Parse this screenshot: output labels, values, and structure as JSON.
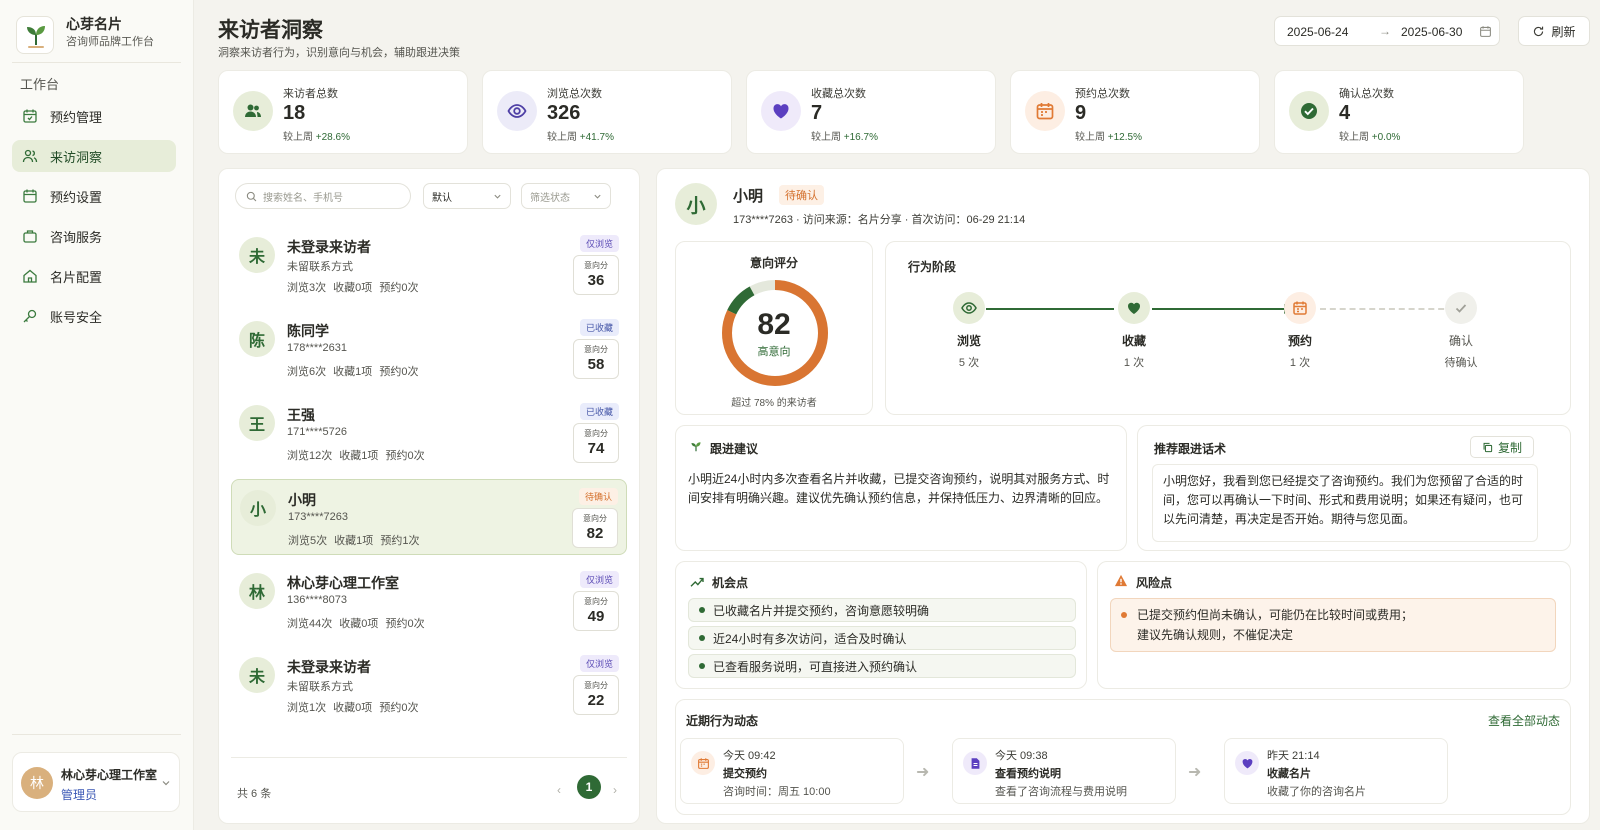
{
  "app": {
    "name": "心芽名片",
    "subtitle": "咨询师品牌工作台"
  },
  "sidebar": {
    "section": "工作台",
    "items": [
      {
        "label": "预约管理",
        "icon": "calendar-icon"
      },
      {
        "label": "来访洞察",
        "icon": "users-icon",
        "active": true
      },
      {
        "label": "预约设置",
        "icon": "calendar-settings-icon"
      },
      {
        "label": "咨询服务",
        "icon": "briefcase-icon"
      },
      {
        "label": "名片配置",
        "icon": "home-icon"
      },
      {
        "label": "账号安全",
        "icon": "key-icon"
      }
    ],
    "user": {
      "avatar": "林",
      "name": "林心芽心理工作室",
      "role": "管理员"
    }
  },
  "header": {
    "title": "来访者洞察",
    "subtitle": "洞察来访者行为，识别意向与机会，辅助跟进决策",
    "date_start": "2025-06-24",
    "date_end": "2025-06-30",
    "refresh_label": "刷新"
  },
  "stats": [
    {
      "label": "来访者总数",
      "value": "18",
      "trend_label": "较上周",
      "trend": "+28.6%",
      "icon": "users-icon",
      "color": "#2f6a35",
      "bg": "#e7edd9"
    },
    {
      "label": "浏览总次数",
      "value": "326",
      "trend_label": "较上周",
      "trend": "+41.7%",
      "icon": "eye-icon",
      "color": "#4e3fa5",
      "bg": "#ecebf8"
    },
    {
      "label": "收藏总次数",
      "value": "7",
      "trend_label": "较上周",
      "trend": "+16.7%",
      "icon": "heart-icon",
      "color": "#5b3fc0",
      "bg": "#efeafa"
    },
    {
      "label": "预约总次数",
      "value": "9",
      "trend_label": "较上周",
      "trend": "+12.5%",
      "icon": "calendar-icon",
      "color": "#e07a35",
      "bg": "#fdeee3"
    },
    {
      "label": "确认总次数",
      "value": "4",
      "trend_label": "较上周",
      "trend": "+0.0%",
      "icon": "check-circle-icon",
      "color": "#2f6a35",
      "bg": "#e7edd9"
    }
  ],
  "list": {
    "search_placeholder": "搜索姓名、手机号",
    "sort_value": "默认",
    "filter_placeholder": "筛选状态",
    "score_label": "意向分",
    "visitors": [
      {
        "avatar": "未",
        "name": "未登录来访者",
        "contact": "未留联系方式",
        "stats": "浏览3次 收藏0项 预约0次",
        "badge": "仅浏览",
        "badge_type": "browse",
        "score": "36"
      },
      {
        "avatar": "陈",
        "name": "陈同学",
        "contact": "178****2631",
        "stats": "浏览6次 收藏1项 预约0次",
        "badge": "已收藏",
        "badge_type": "fav",
        "score": "58"
      },
      {
        "avatar": "王",
        "name": "王强",
        "contact": "171****5726",
        "stats": "浏览12次 收藏1项 预约0次",
        "badge": "已收藏",
        "badge_type": "fav",
        "score": "74"
      },
      {
        "avatar": "小",
        "name": "小明",
        "contact": "173****7263",
        "stats": "浏览5次 收藏1项 预约1次",
        "badge": "待确认",
        "badge_type": "pend",
        "score": "82",
        "active": true
      },
      {
        "avatar": "林",
        "name": "林心芽心理工作室",
        "contact": "136****8073",
        "stats": "浏览44次 收藏0项 预约0次",
        "badge": "仅浏览",
        "badge_type": "browse",
        "score": "49"
      },
      {
        "avatar": "未",
        "name": "未登录来访者",
        "contact": "未留联系方式",
        "stats": "浏览1次 收藏0项 预约0次",
        "badge": "仅浏览",
        "badge_type": "browse",
        "score": "22"
      }
    ],
    "total": "共 6 条",
    "page": "1"
  },
  "detail": {
    "avatar": "小",
    "name": "小明",
    "status": "待确认",
    "meta": "173****7263 · 访问来源：名片分享 · 首次访问：06-29 21:14",
    "score": {
      "title": "意向评分",
      "value": 82,
      "level": "高意向",
      "note": "超过 78% 的来访者",
      "accent": "#d97532",
      "track": "#2f6a35"
    },
    "stages": {
      "title": "行为阶段",
      "items": [
        {
          "name": "浏览",
          "sub": "5 次",
          "icon": "eye-icon",
          "done": true
        },
        {
          "name": "收藏",
          "sub": "1 次",
          "icon": "heart-icon",
          "done": true
        },
        {
          "name": "预约",
          "sub": "1 次",
          "icon": "calendar-icon",
          "done": true
        },
        {
          "name": "确认",
          "sub": "待确认",
          "icon": "check-icon",
          "done": false
        }
      ]
    },
    "suggestion": {
      "title": "跟进建议",
      "text": "小明近24小时内多次查看名片并收藏，已提交咨询预约，说明其对服务方式、时间安排有明确兴趣。建议优先确认预约信息，并保持低压力、边界清晰的回应。"
    },
    "script": {
      "title": "推荐跟进话术",
      "copy_label": "复制",
      "text": "小明您好，我看到您已经提交了咨询预约。我们为您预留了合适的时间，您可以再确认一下时间、形式和费用说明；如果还有疑问，也可以先问清楚，再决定是否开始。期待与您见面。"
    },
    "opportunities": {
      "title": "机会点",
      "items": [
        "已收藏名片并提交预约，咨询意愿较明确",
        "近24小时有多次访问，适合及时确认",
        "已查看服务说明，可直接进入预约确认"
      ]
    },
    "risks": {
      "title": "风险点",
      "items": [
        "已提交预约但尚未确认，可能仍在比较时间或费用；",
        "建议先确认规则，不催促决定"
      ]
    },
    "activity": {
      "title": "近期行为动态",
      "view_all": "查看全部动态",
      "items": [
        {
          "time": "今天 09:42",
          "title": "提交预约",
          "desc": "咨询时间：周五 10:00",
          "icon": "calendar-icon",
          "color": "#e07a35",
          "bg": "#fdeee3"
        },
        {
          "time": "今天 09:38",
          "title": "查看预约说明",
          "desc": "查看了咨询流程与费用说明",
          "icon": "document-icon",
          "color": "#5b3fc0",
          "bg": "#efeafa"
        },
        {
          "time": "昨天 21:14",
          "title": "收藏名片",
          "desc": "收藏了你的咨询名片",
          "icon": "heart-icon",
          "color": "#5b3fc0",
          "bg": "#efeafa"
        }
      ]
    }
  }
}
